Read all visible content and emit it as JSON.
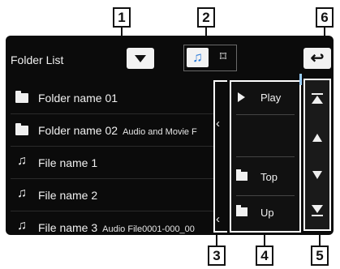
{
  "callouts": {
    "c1": "1",
    "c2": "2",
    "c3": "3",
    "c4": "4",
    "c5": "5",
    "c6": "6"
  },
  "header": {
    "title": "Folder List",
    "back_icon": "back-arrow-icon"
  },
  "list": {
    "items": [
      {
        "type": "folder",
        "name": "Folder name 01",
        "sub": ""
      },
      {
        "type": "folder",
        "name": "Folder name 02",
        "sub": "Audio and Movie F"
      },
      {
        "type": "file",
        "name": "File name 1",
        "sub": ""
      },
      {
        "type": "file",
        "name": "File name 2",
        "sub": ""
      },
      {
        "type": "file",
        "name": "File name 3",
        "sub": "Audio File0001-000_00"
      }
    ]
  },
  "menu": {
    "play": "Play",
    "top": "Top",
    "up": "Up"
  },
  "glyphs": {
    "note": "♫",
    "video": "⌑",
    "collapse": "‹",
    "back": "↩",
    "first": "⇤",
    "prev": "▲",
    "next": "▼",
    "last": "⇥"
  },
  "colors": {
    "accent": "#2a7ad8",
    "indicator": "#9bd0ff"
  }
}
